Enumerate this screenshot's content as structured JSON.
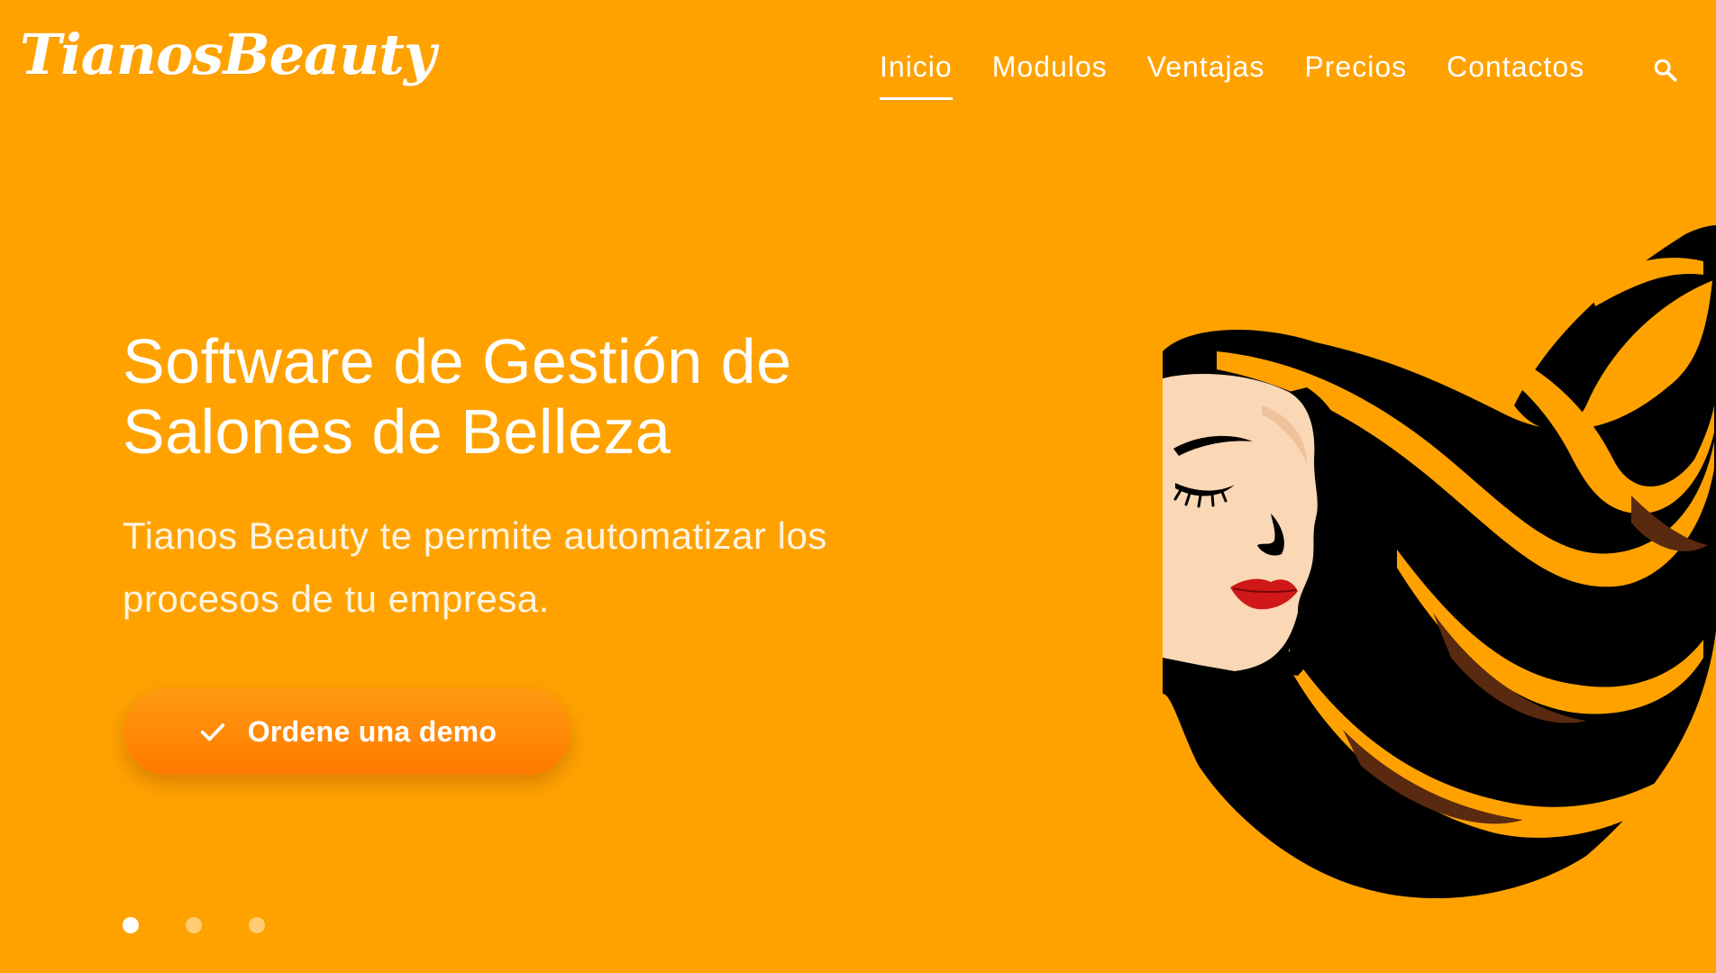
{
  "brand": {
    "logo_text": "TianosBeauty"
  },
  "nav": {
    "items": [
      {
        "label": "Inicio",
        "active": true
      },
      {
        "label": "Modulos",
        "active": false
      },
      {
        "label": "Ventajas",
        "active": false
      },
      {
        "label": "Precios",
        "active": false
      },
      {
        "label": "Contactos",
        "active": false
      }
    ],
    "search_icon": "search-icon"
  },
  "hero": {
    "title_line1": "Software de Gestión de",
    "title_line2": "Salones de Belleza",
    "subtitle_line1": "Tianos Beauty te permite automatizar los",
    "subtitle_line2": "procesos de tu empresa.",
    "cta_label": "Ordene una demo",
    "cta_icon": "check-icon"
  },
  "slider": {
    "count": 3,
    "active_index": 0
  },
  "colors": {
    "background": "#FFA200",
    "cta": "#FF8A00",
    "text": "#FFFFFF",
    "hair": "#000000",
    "skin": "#FAD7B5",
    "lips": "#D01818"
  }
}
